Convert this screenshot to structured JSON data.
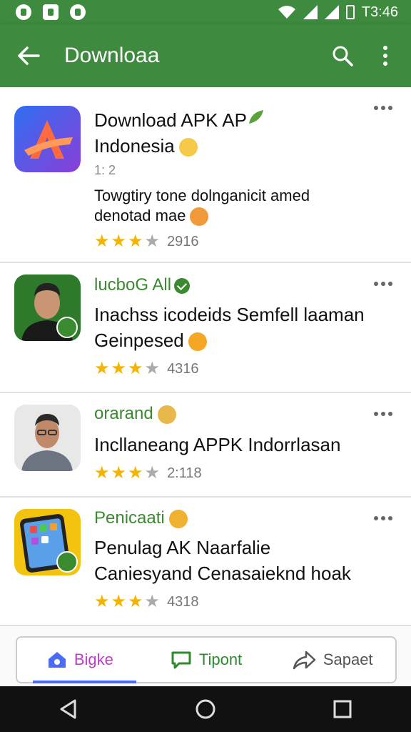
{
  "status_bar": {
    "time": "T3:46"
  },
  "app_bar": {
    "title": "Downloaa"
  },
  "apps": [
    {
      "name": "Download APK AP",
      "name_line2": "Indonesia",
      "meta": "1: 2",
      "description": "Towgtiry tone dolnganicit amed denotad mae",
      "stars": 3,
      "rating_count": "2916"
    },
    {
      "name": "lucboG All",
      "title": "Inachss icodeids Semfell laaman Geinpesed",
      "stars": 3,
      "rating_count": "4316"
    },
    {
      "name": "orarand",
      "title": "Incllaneang APPK Indorrlasan",
      "stars": 3,
      "rating_count": "2:118"
    },
    {
      "name": "Penicaati",
      "title": "Penulag AK Naarfalie Caniesyand Cenasaieknd hoak",
      "stars": 3,
      "rating_count": "4318"
    }
  ],
  "tabs": [
    {
      "label": "Bigke",
      "icon": "home-icon"
    },
    {
      "label": "Tipont",
      "icon": "chat-icon"
    },
    {
      "label": "Sapaet",
      "icon": "share-icon"
    }
  ],
  "colors": {
    "primary": "#3e8a3e",
    "star": "#f4b400",
    "tab_indicator": "#4a6cf7"
  }
}
